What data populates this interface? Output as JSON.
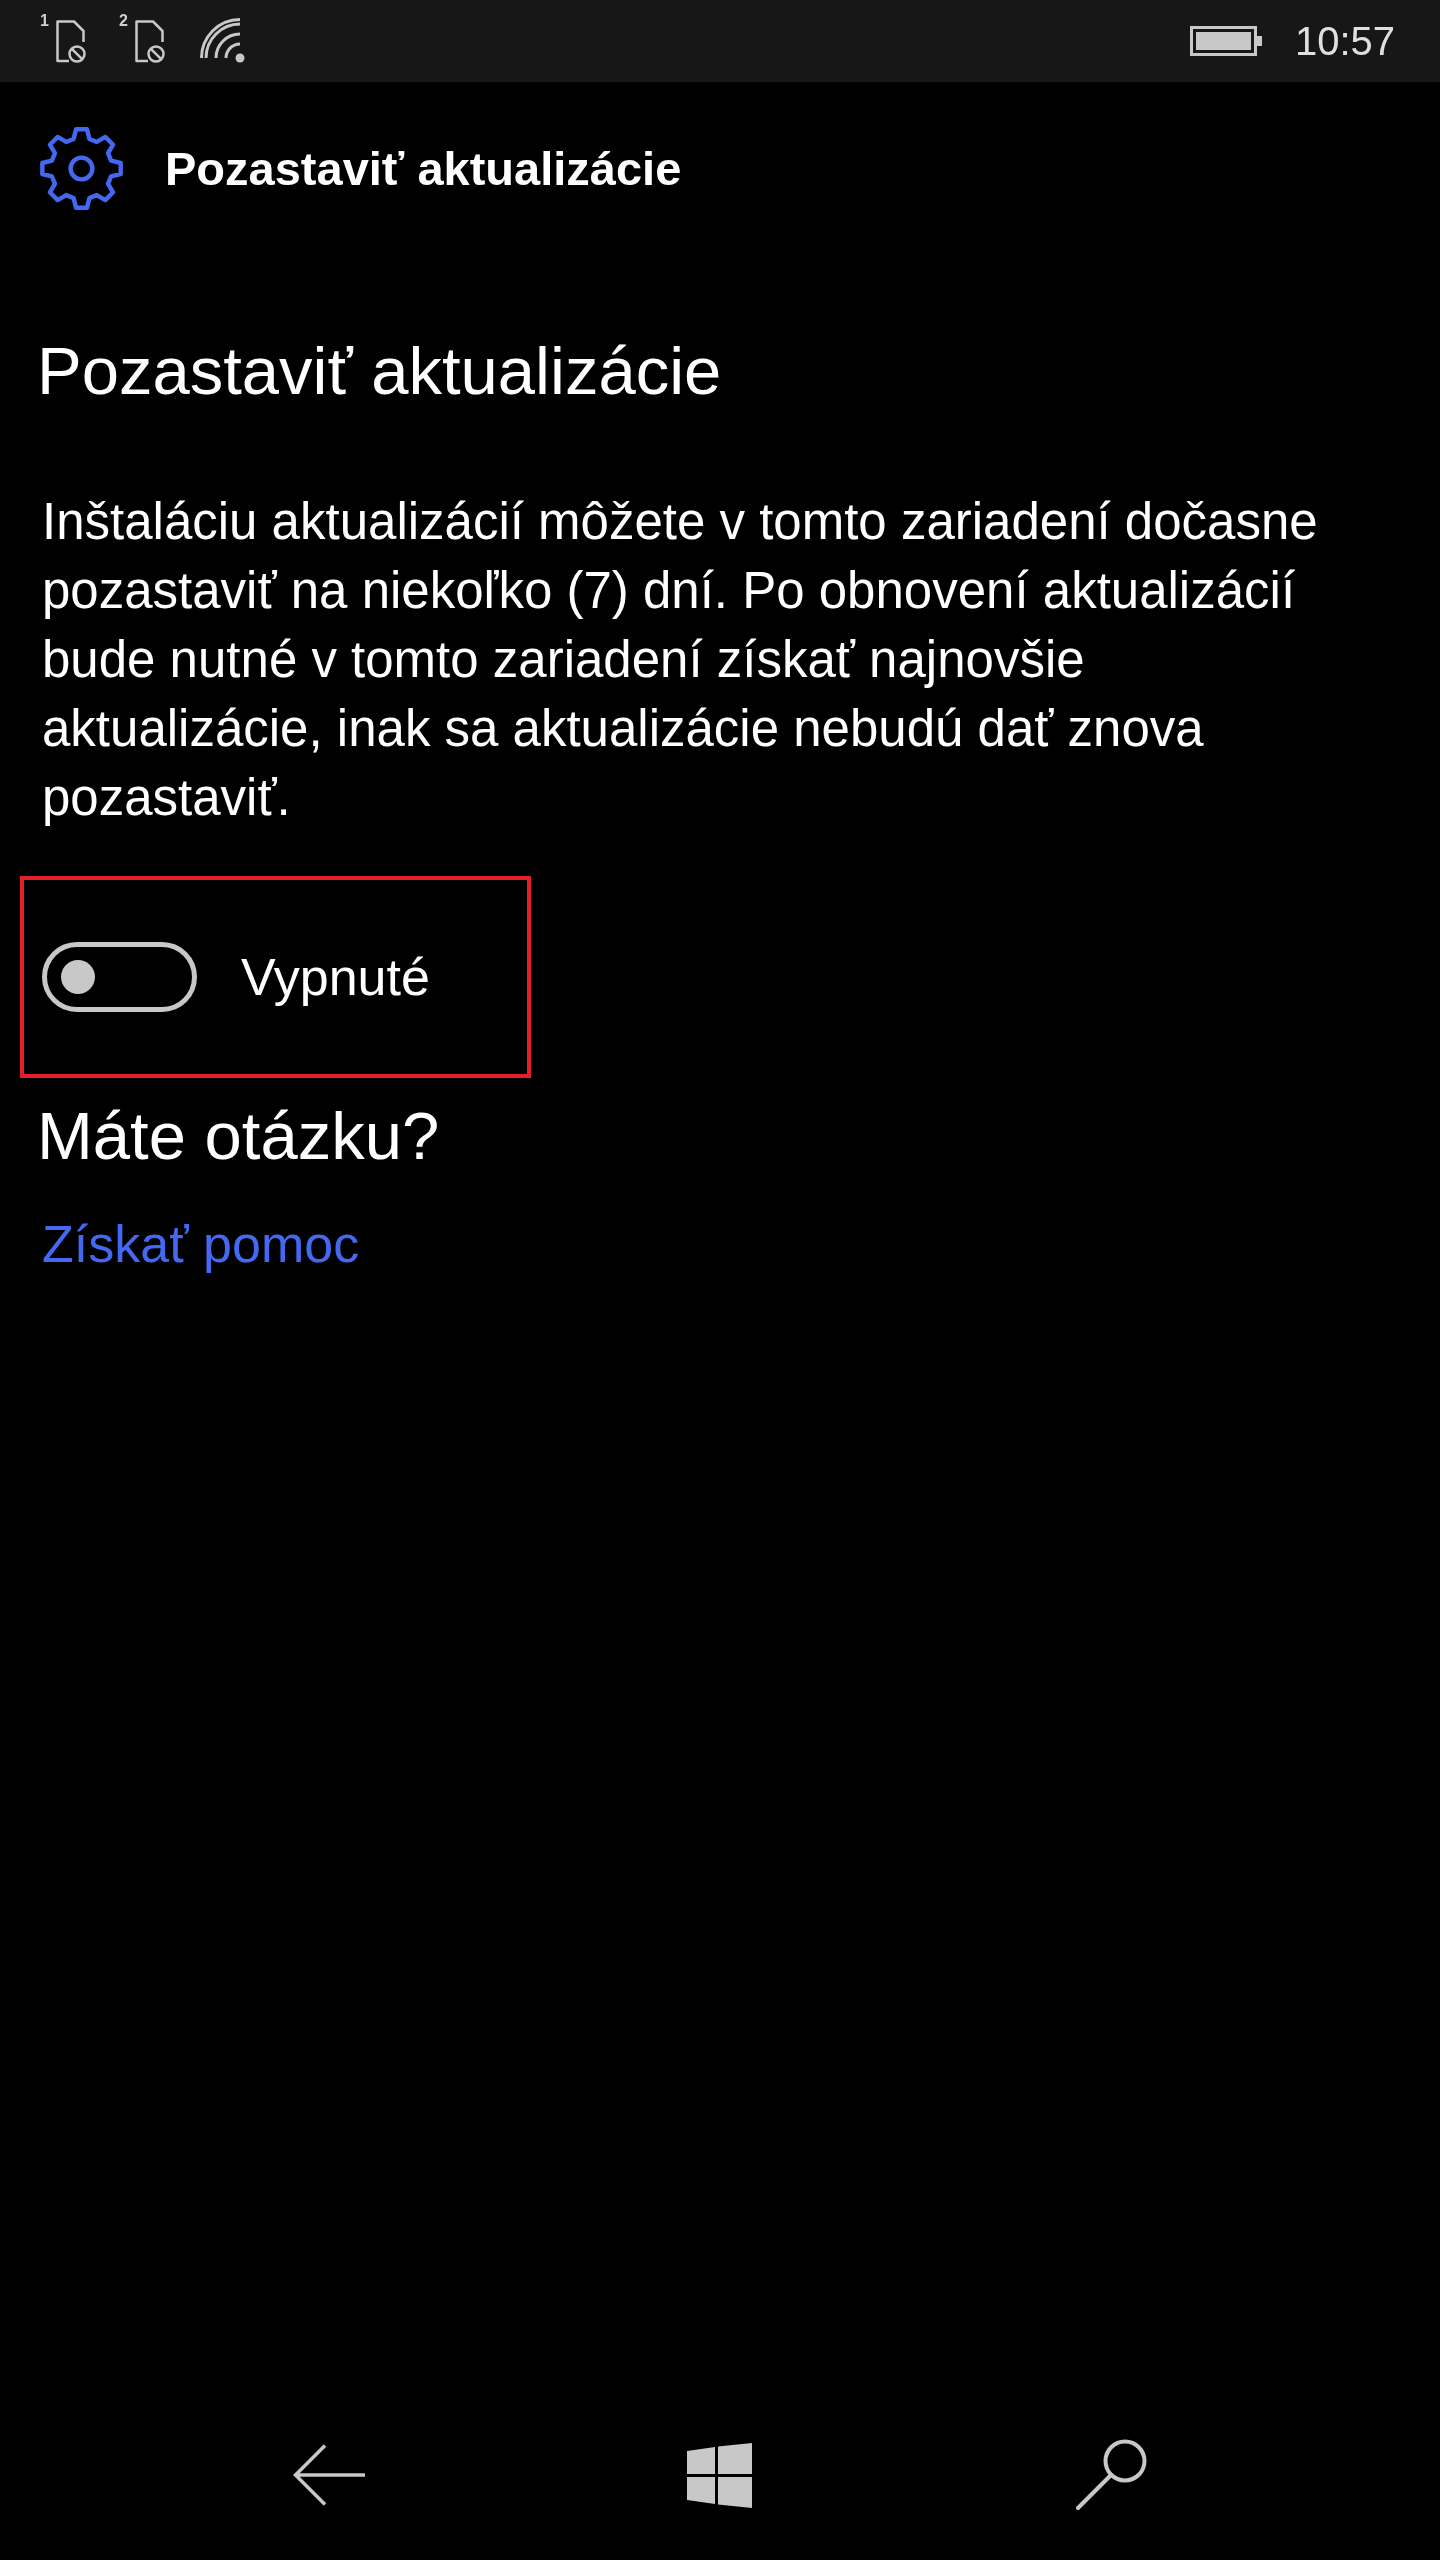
{
  "status_bar": {
    "sim_slots": [
      "1",
      "2"
    ],
    "time": "10:57"
  },
  "header": {
    "title": "Pozastaviť aktualizácie"
  },
  "content": {
    "heading": "Pozastaviť aktualizácie",
    "description": "Inštaláciu aktualizácií môžete v tomto zariadení dočasne pozastaviť na niekoľko (7) dní. Po obnovení aktualizácií bude nutné v tomto zariadení získať najnovšie aktualizácie, inak sa aktualizácie nebudú dať znova pozastaviť.",
    "toggle": {
      "label": "Vypnuté",
      "on": false,
      "highlighted": true
    }
  },
  "help": {
    "heading": "Máte otázku?",
    "link": "Získať pomoc"
  }
}
